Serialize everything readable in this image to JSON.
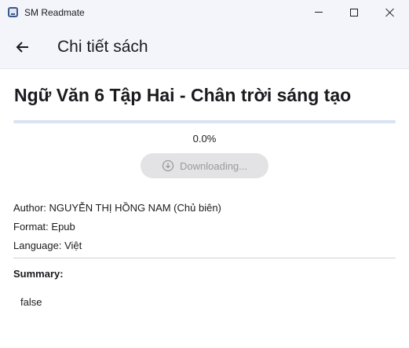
{
  "window": {
    "title": "SM Readmate",
    "icon": "app-book-icon"
  },
  "appbar": {
    "back_icon": "arrow-left-icon",
    "title": "Chi tiết sách"
  },
  "book": {
    "title": "Ngữ Văn 6 Tập Hai - Chân trời sáng tạo",
    "progress_fraction": 0.0,
    "progress_text": "0.0%",
    "download_label": "Downloading...",
    "download_icon": "download-circle-icon",
    "author_line": "Author: NGUYỄN THỊ HỒNG NAM (Chủ biên)",
    "format_line": "Format: Epub",
    "language_line": "Language: Việt",
    "summary_heading": "Summary:",
    "summary_text": "false"
  },
  "colors": {
    "titlebar_bg": "#f3f5fb",
    "progress_track": "#d8e3f3",
    "button_disabled_bg": "#e3e3e5",
    "button_disabled_text": "#9a9aa0"
  }
}
